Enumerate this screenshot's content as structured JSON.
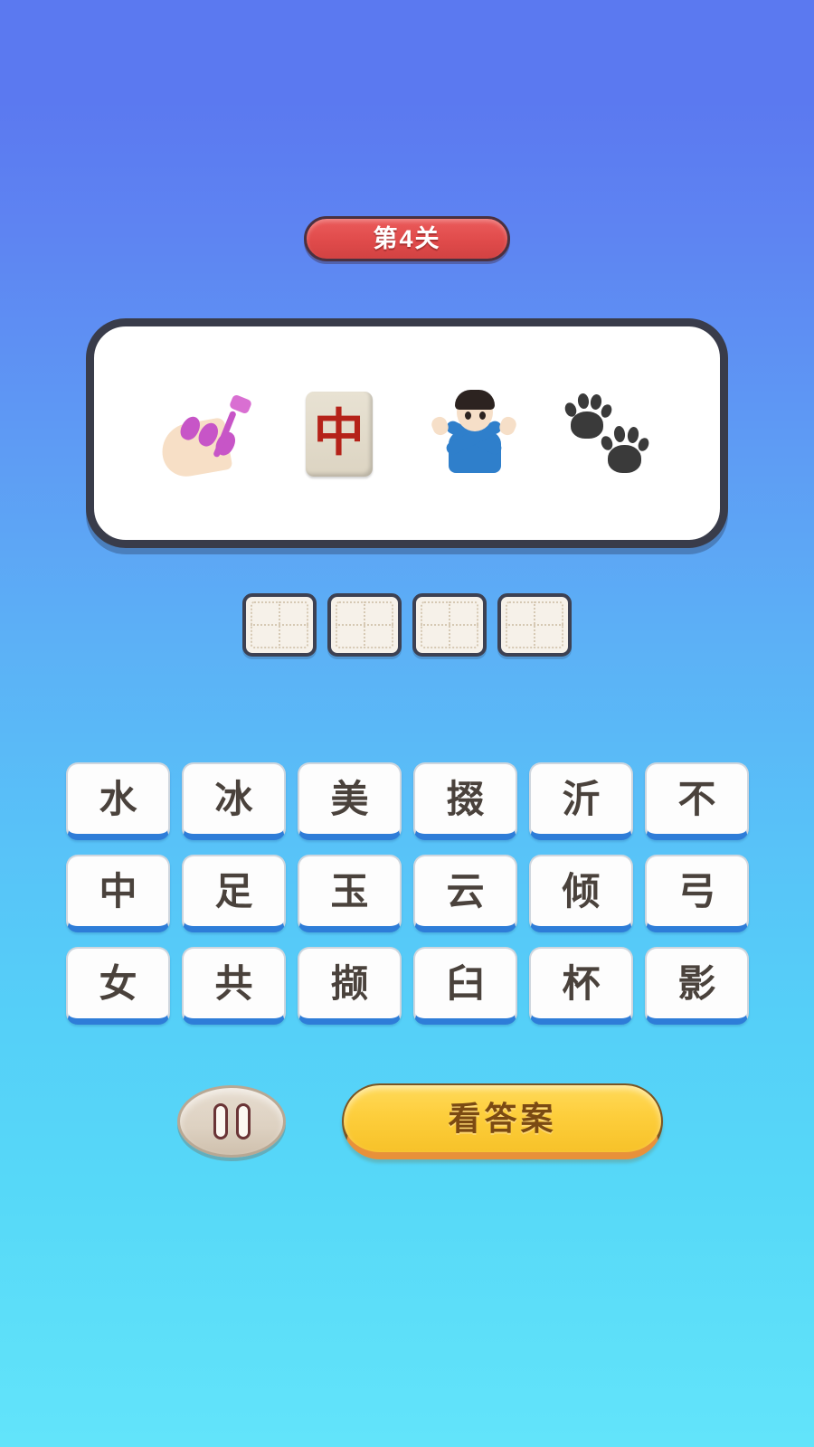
{
  "level": {
    "badge_label": "第4关"
  },
  "clue": {
    "emojis": [
      {
        "name": "nail-polish-emoji",
        "glyph": "💅"
      },
      {
        "name": "mahjong-red-dragon-emoji",
        "glyph": "🀄",
        "inner_char": "中"
      },
      {
        "name": "person-gesturing-no-emoji",
        "glyph": "🙅"
      },
      {
        "name": "paw-prints-emoji",
        "glyph": "🐾"
      }
    ]
  },
  "answer": {
    "slot_count": 4,
    "slots": [
      "",
      "",
      "",
      ""
    ]
  },
  "tiles": {
    "rows": [
      [
        "水",
        "冰",
        "美",
        "掇",
        "沂",
        "不"
      ],
      [
        "中",
        "足",
        "玉",
        "云",
        "倾",
        "弓"
      ],
      [
        "女",
        "共",
        "撷",
        "臼",
        "杯",
        "影"
      ]
    ]
  },
  "controls": {
    "pause_label": "",
    "show_answer_label": "看答案"
  },
  "colors": {
    "background_top": "#5B79F0",
    "background_bottom": "#62E4FA",
    "badge_red": "#E04B4B",
    "card_border": "#393C4A",
    "tile_shadow_blue": "#2E7DD8",
    "answer_button_yellow": "#FDCE3C",
    "answer_button_text": "#7B4A13",
    "slot_fill": "#F6F1E9"
  }
}
